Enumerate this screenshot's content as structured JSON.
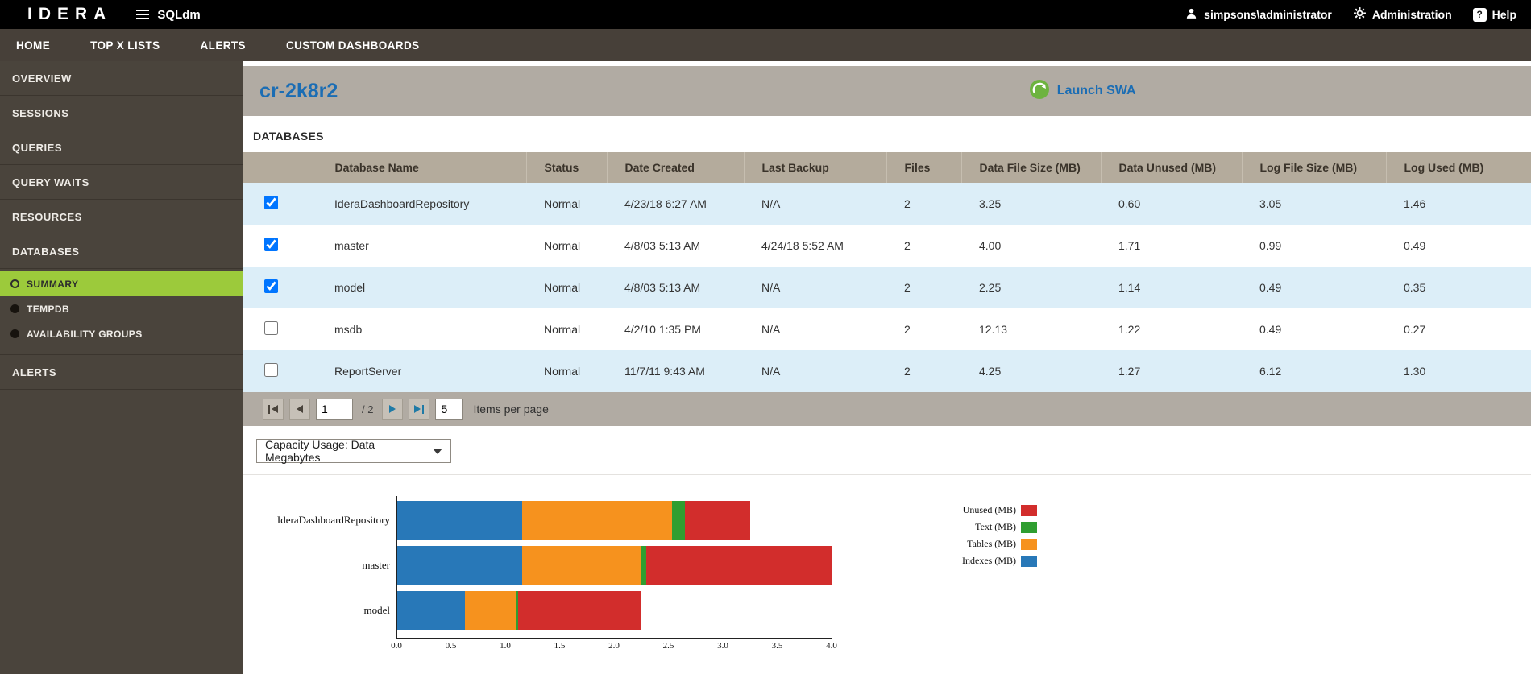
{
  "topbar": {
    "brand": "IDERA",
    "app_name": "SQLdm",
    "user": "simpsons\\administrator",
    "admin_label": "Administration",
    "help_label": "Help",
    "help_icon": "?"
  },
  "nav": {
    "items": [
      "HOME",
      "TOP X LISTS",
      "ALERTS",
      "CUSTOM DASHBOARDS"
    ]
  },
  "sidebar": {
    "items_top": [
      "OVERVIEW",
      "SESSIONS",
      "QUERIES",
      "QUERY WAITS",
      "RESOURCES"
    ],
    "databases_label": "DATABASES",
    "databases_children": [
      "SUMMARY",
      "TEMPDB",
      "AVAILABILITY GROUPS"
    ],
    "active_child": "SUMMARY",
    "alerts_label": "ALERTS"
  },
  "header": {
    "server_name": "cr-2k8r2",
    "launch_swa_label": "Launch SWA"
  },
  "databases_section": {
    "title": "DATABASES",
    "columns": [
      "Database Name",
      "Status",
      "Date Created",
      "Last Backup",
      "Files",
      "Data File Size (MB)",
      "Data Unused (MB)",
      "Log File Size (MB)",
      "Log Used (MB)"
    ],
    "rows": [
      {
        "checked": true,
        "cells": [
          "IderaDashboardRepository",
          "Normal",
          "4/23/18 6:27 AM",
          "N/A",
          "2",
          "3.25",
          "0.60",
          "3.05",
          "1.46"
        ]
      },
      {
        "checked": true,
        "cells": [
          "master",
          "Normal",
          "4/8/03 5:13 AM",
          "4/24/18 5:52 AM",
          "2",
          "4.00",
          "1.71",
          "0.99",
          "0.49"
        ]
      },
      {
        "checked": true,
        "cells": [
          "model",
          "Normal",
          "4/8/03 5:13 AM",
          "N/A",
          "2",
          "2.25",
          "1.14",
          "0.49",
          "0.35"
        ]
      },
      {
        "checked": false,
        "cells": [
          "msdb",
          "Normal",
          "4/2/10 1:35 PM",
          "N/A",
          "2",
          "12.13",
          "1.22",
          "0.49",
          "0.27"
        ]
      },
      {
        "checked": false,
        "cells": [
          "ReportServer",
          "Normal",
          "11/7/11 9:43 AM",
          "N/A",
          "2",
          "4.25",
          "1.27",
          "6.12",
          "1.30"
        ]
      }
    ]
  },
  "pagination": {
    "page": "1",
    "page_total": "/ 2",
    "items_per_page_value": "5",
    "items_per_page_label": "Items per page"
  },
  "capacity_select": {
    "selected": "Capacity Usage: Data Megabytes"
  },
  "chart_data": {
    "type": "bar",
    "orientation": "horizontal",
    "stacked": true,
    "categories": [
      "IderaDashboardRepository",
      "master",
      "model"
    ],
    "series": [
      {
        "name": "Indexes (MB)",
        "color": "#2878b8",
        "values": [
          1.15,
          1.15,
          0.62
        ]
      },
      {
        "name": "Tables (MB)",
        "color": "#f6921e",
        "values": [
          1.38,
          1.09,
          0.47
        ]
      },
      {
        "name": "Text (MB)",
        "color": "#2f9e30",
        "values": [
          0.12,
          0.05,
          0.02
        ]
      },
      {
        "name": "Unused (MB)",
        "color": "#d22d2c",
        "values": [
          0.6,
          1.71,
          1.14
        ]
      }
    ],
    "legend_order": [
      "Unused (MB)",
      "Text (MB)",
      "Tables (MB)",
      "Indexes (MB)"
    ],
    "xlim": [
      0,
      4
    ],
    "xticks": [
      0,
      0.5,
      1,
      1.5,
      2,
      2.5,
      3,
      3.5,
      4
    ],
    "title": "Capacity Usage: Data Megabytes",
    "grid": false,
    "legend_position": "top-right"
  }
}
